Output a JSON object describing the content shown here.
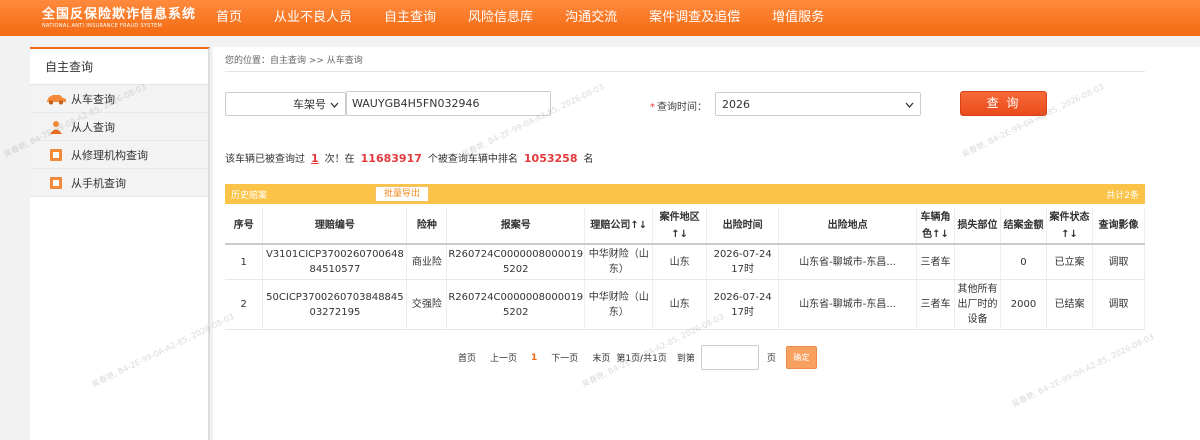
{
  "header": {
    "logo_cn": "全国反保险欺诈信息系统",
    "logo_en": "NATIONAL ANTI INSURANCE FRAUD SYSTEM",
    "nav": [
      "首页",
      "从业不良人员",
      "自主查询",
      "风险信息库",
      "沟通交流",
      "案件调查及追偿",
      "增值服务"
    ]
  },
  "sidebar": {
    "title": "自主查询",
    "items": [
      {
        "label": "从车查询",
        "icon": "car-icon"
      },
      {
        "label": "从人查询",
        "icon": "person-icon"
      },
      {
        "label": "从修理机构查询",
        "icon": "repair-icon"
      },
      {
        "label": "从手机查询",
        "icon": "phone-icon"
      }
    ]
  },
  "breadcrumb": "您的位置：自主查询 >> 从车查询",
  "search": {
    "type_label": "车架号",
    "vin_value": "WAUYGB4H5FN032946",
    "time_label": "查询时间：",
    "year_value": "2026",
    "button": "查 询"
  },
  "stats": {
    "t1": "该车辆已被查询过",
    "count": "1",
    "t2": "次！在",
    "total": "11683917",
    "t3": "个被查询车辆中排名",
    "rank": "1053258",
    "t4": "名"
  },
  "history": {
    "title": "历史赔案",
    "export": "批量导出",
    "count": "共计2条"
  },
  "table": {
    "headers": [
      "序号",
      "理赔编号",
      "险种",
      "报案号",
      "理赔公司↑↓",
      "案件地区↑↓",
      "出险时间",
      "出险地点",
      "车辆角色↑↓",
      "损失部位",
      "结案金额",
      "案件状态↑↓",
      "查询影像"
    ],
    "rows": [
      {
        "no": "1",
        "claim": "V3101CICP370026070064884510577",
        "type": "商业险",
        "report": "R260724C00000080000195202",
        "company": "中华财险（山东）",
        "region": "山东",
        "time": "2026-07-24 17时",
        "place": "山东省-聊城市-东昌...",
        "role": "三者车",
        "loss": "",
        "amount": "0",
        "status": "已立案",
        "action": "调取"
      },
      {
        "no": "2",
        "claim": "50CICP370026070384884503272195",
        "type": "交强险",
        "report": "R260724C00000080000195202",
        "company": "中华财险（山东）",
        "region": "山东",
        "time": "2026-07-24 17时",
        "place": "山东省-聊城市-东昌...",
        "role": "三者车",
        "loss": "其他所有出厂时的设备",
        "amount": "2000",
        "status": "已结案",
        "action": "调取"
      }
    ]
  },
  "pager": {
    "first": "首页",
    "prev": "上一页",
    "current": "1",
    "next": "下一页",
    "last": "末页",
    "info": "第1页/共1页",
    "goto": "到第",
    "page_unit": "页",
    "ok": "确定"
  },
  "watermark": "吴春艳, B4-2E-99-0A-A2-85, 2026-08-03"
}
